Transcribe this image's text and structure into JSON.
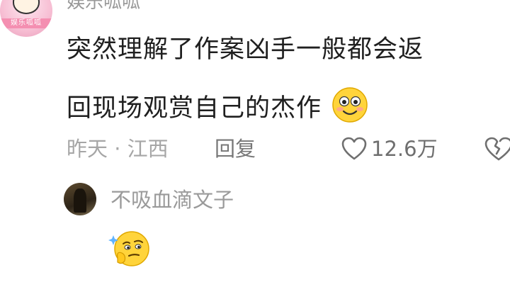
{
  "comment": {
    "username": "娱乐呱呱",
    "avatar_badge": "娱乐呱呱",
    "text_line1": "突然理解了作案凶手一般都会返",
    "text_line2": "回现场观赏自己的杰作",
    "emoji": "smile-emoji",
    "meta": "昨天 · 江西",
    "reply_label": "回复",
    "like_count": "12.6万"
  },
  "reply": {
    "username": "不吸血滴文子",
    "emoji": "thinking-emoji"
  },
  "colors": {
    "primary_text": "#1f1f1f",
    "secondary_text": "#a6a6a6",
    "icon": "#6f6f6f"
  }
}
